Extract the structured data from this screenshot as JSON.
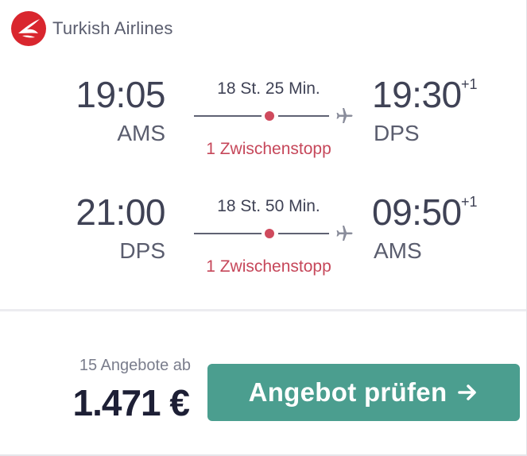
{
  "airline": {
    "name": "Turkish Airlines",
    "logo_icon": "turkish-airlines-logo",
    "brand_color": "#d9262e"
  },
  "legs": [
    {
      "departure_time": "19:05",
      "departure_airport": "AMS",
      "duration": "18 St. 25 Min.",
      "stops": "1 Zwischenstopp",
      "arrival_time": "19:30",
      "arrival_day_offset": "+1",
      "arrival_airport": "DPS"
    },
    {
      "departure_time": "21:00",
      "departure_airport": "DPS",
      "duration": "18 St. 50 Min.",
      "stops": "1 Zwischenstopp",
      "arrival_time": "09:50",
      "arrival_day_offset": "+1",
      "arrival_airport": "AMS"
    }
  ],
  "offers_label": "15 Angebote ab",
  "price": "1.471 €",
  "cta": {
    "label": "Angebot prüfen",
    "icon": "arrow-right-icon",
    "color": "#4b9e8f"
  },
  "colors": {
    "stop_accent": "#c6475a",
    "text_primary": "#3f4255"
  }
}
